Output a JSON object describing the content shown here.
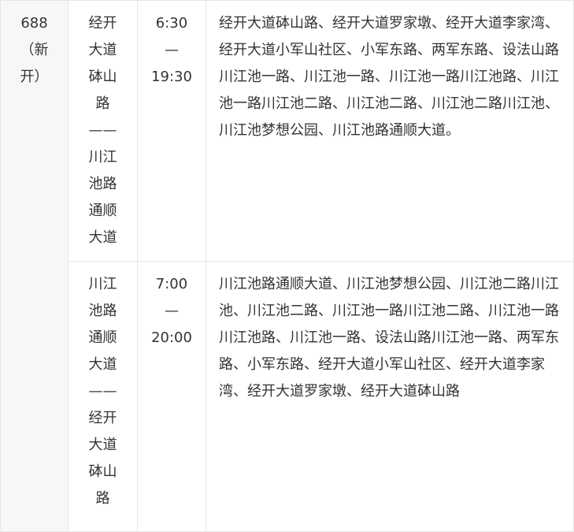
{
  "route": {
    "lines": [
      "688",
      "（新",
      "开）"
    ]
  },
  "rows": [
    {
      "direction_lines": [
        "经开",
        "大道",
        "砵山",
        "路",
        "——",
        "川江",
        "池路",
        "通顺",
        "大道"
      ],
      "time_lines": [
        "6:30",
        "—",
        "19:30"
      ],
      "stops": "经开大道砵山路、经开大道罗家墩、经开大道李家湾、经开大道小军山社区、小军东路、两军东路、设法山路川江池一路、川江池一路、川江池一路川江池路、川江池一路川江池二路、川江池二路、川江池二路川江池、川江池梦想公园、川江池路通顺大道。"
    },
    {
      "direction_lines": [
        "川江",
        "池路",
        "通顺",
        "大道",
        "——",
        "经开",
        "大道",
        "砵山",
        "路"
      ],
      "time_lines": [
        "7:00",
        "—",
        "20:00"
      ],
      "stops": "川江池路通顺大道、川江池梦想公园、川江池二路川江池、川江池二路、川江池一路川江池二路、川江池一路川江池路、川江池一路、设法山路川江池一路、两军东路、小军东路、经开大道小军山社区、经开大道李家湾、经开大道罗家墩、经开大道砵山路"
    }
  ]
}
